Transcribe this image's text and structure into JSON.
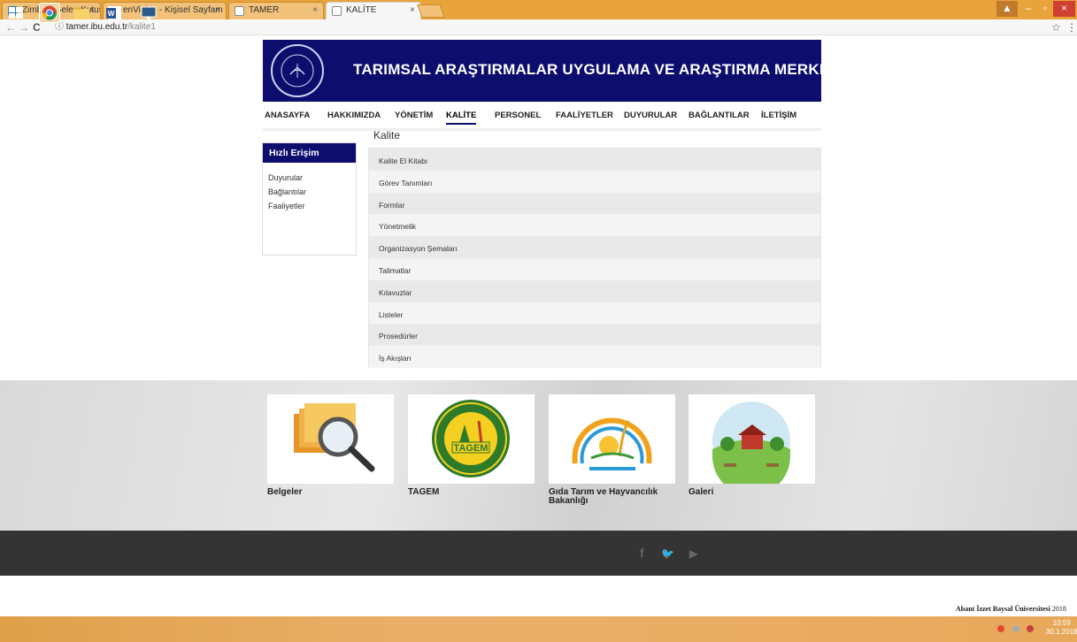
{
  "browser": {
    "tabs": [
      {
        "title": "Zimbra: Gelen Kutusu",
        "icon": "zimbra-icon",
        "active": false
      },
      {
        "title": "enVision - Kişisel Sayfam",
        "icon": "envision-icon",
        "active": false
      },
      {
        "title": "TAMER",
        "icon": "page-icon",
        "active": false
      },
      {
        "title": "KALİTE",
        "icon": "page-icon",
        "active": true
      }
    ],
    "close_glyph": "×",
    "url_host": "tamer.ibu.edu.tr",
    "url_path": "/kalite1",
    "back_glyph": "←",
    "forward_glyph": "→",
    "reload_glyph": "C",
    "info_glyph": "ⓘ",
    "star_glyph": "☆",
    "menu_glyph": "⋮",
    "win_minimize": "–",
    "win_maximize": "▫",
    "win_close": "×",
    "win_user": "▲"
  },
  "site": {
    "title": "TARIMSAL ARAŞTIRMALAR UYGULAMA VE ARAŞTIRMA MERKEZİ",
    "logo_text": "ABANT İZZET BAYSAL ÜNİVERSİTESİ",
    "nav": [
      "ANASAYFA",
      "HAKKIMIZDA",
      "YÖNETİM",
      "KALİTE",
      "PERSONEL",
      "FAALİYETLER",
      "DUYURULAR",
      "BAĞLANTILAR",
      "İLETİŞİM"
    ],
    "active_nav": "KALİTE"
  },
  "sidebar": {
    "heading": "Hızlı Erişim",
    "links": [
      "Duyurular",
      "Bağlantılar",
      "Faaliyetler"
    ]
  },
  "content": {
    "title": "Kalite",
    "items": [
      "Kalite El Kitabı",
      "Görev Tanımları",
      "Formlar",
      "Yönetmelik",
      "Organizasyon Şemaları",
      "Talimatlar",
      "Kılavuzlar",
      "Listeler",
      "Prosedürler",
      "İş Akışları"
    ]
  },
  "cards": [
    {
      "label": "Belgeler",
      "image": "folders-magnifier-image"
    },
    {
      "label": "TAGEM",
      "image": "tagem-logo-image",
      "logo_text": "TAGEM"
    },
    {
      "label": "Gıda Tarım ve Hayvancılık Bakanlığı",
      "image": "ministry-logo-image"
    },
    {
      "label": "Galeri",
      "image": "farm-illustration-image"
    }
  ],
  "footer": {
    "social": [
      "f",
      "🐦",
      "▶"
    ],
    "copyright_bold": "Abant İzzet Baysal Üniversitesi",
    "copyright_year": "2018"
  },
  "taskbar": {
    "time": "10:59",
    "date": "30.1.2018"
  },
  "colors": {
    "brand_navy": "#0d0d6e",
    "taskbar_orange": "#e8a33a",
    "dark_footer": "#343434"
  }
}
